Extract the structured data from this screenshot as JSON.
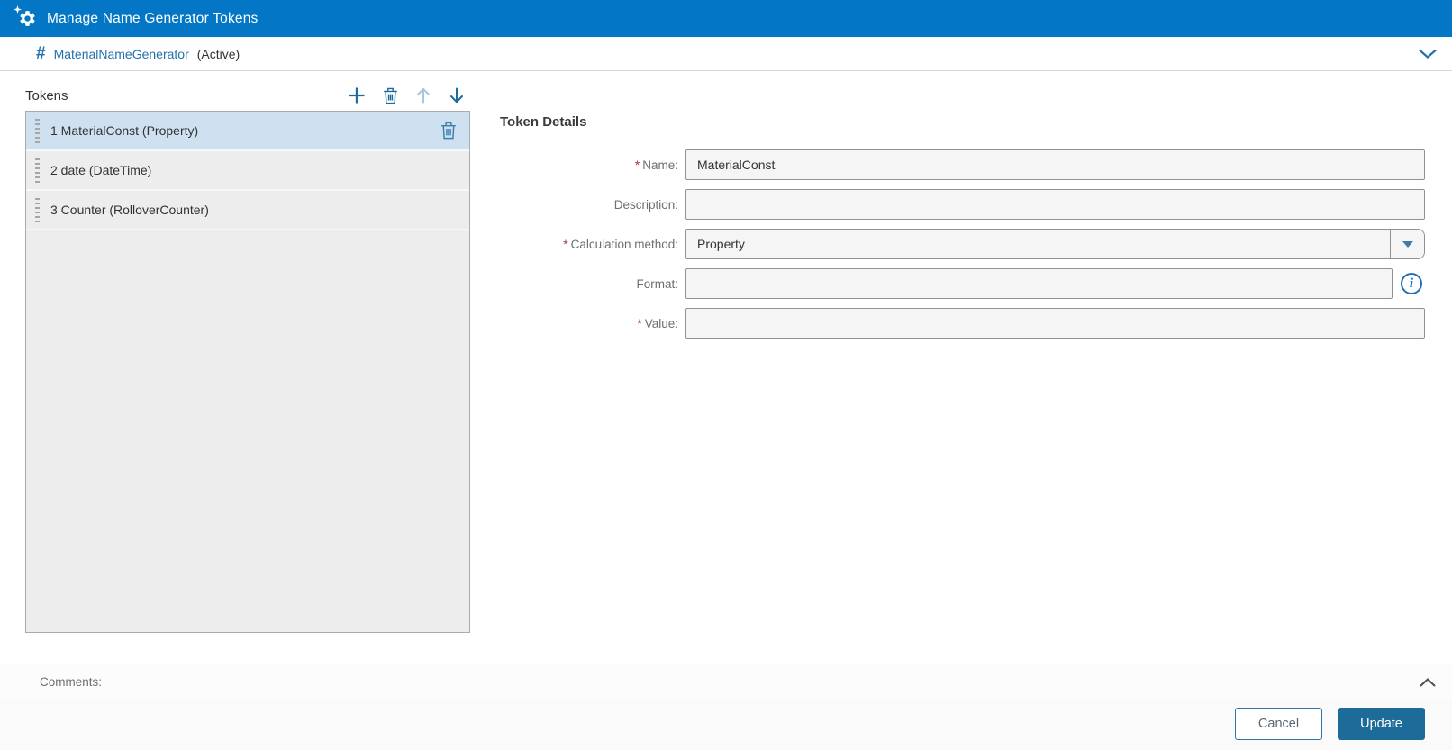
{
  "titlebar": {
    "title": "Manage Name Generator Tokens",
    "icon": "gear-with-spark-icon"
  },
  "subheader": {
    "hash_symbol": "#",
    "generator_name": "MaterialNameGenerator",
    "status": "(Active)",
    "collapse_icon": "chevron-down-icon"
  },
  "tokens_panel": {
    "title": "Tokens",
    "toolbar": {
      "add_icon": "plus-icon",
      "delete_icon": "trash-icon",
      "move_up_icon": "arrow-up-icon",
      "move_up_disabled": true,
      "move_down_icon": "arrow-down-icon"
    },
    "items": [
      {
        "label": "1 MaterialConst (Property)",
        "selected": true,
        "row_delete_icon": "trash-icon"
      },
      {
        "label": "2 date (DateTime)",
        "selected": false
      },
      {
        "label": "3 Counter (RolloverCounter)",
        "selected": false
      }
    ]
  },
  "details_panel": {
    "title": "Token Details",
    "required_marker": "*",
    "fields": {
      "name": {
        "label": "Name:",
        "required": true,
        "value": "MaterialConst",
        "type": "text"
      },
      "description": {
        "label": "Description:",
        "required": false,
        "value": "",
        "type": "text"
      },
      "calculation_method": {
        "label": "Calculation method:",
        "required": true,
        "value": "Property",
        "type": "select"
      },
      "format": {
        "label": "Format:",
        "required": false,
        "value": "",
        "type": "text",
        "info_icon": "info-icon"
      },
      "value": {
        "label": "Value:",
        "required": true,
        "value": "",
        "type": "text"
      }
    }
  },
  "comments": {
    "label": "Comments:",
    "collapse_icon": "chevron-up-icon"
  },
  "footer": {
    "cancel_label": "Cancel",
    "update_label": "Update"
  },
  "colors": {
    "header_bg": "#0377c6",
    "accent_blue": "#2271ab",
    "toolbar_icon_blue": "#1d6a9e",
    "disabled_icon_blue": "#a9c6de",
    "selected_row_bg": "#cfe1f1",
    "input_bg": "#f5f5f5",
    "input_border": "#919191",
    "required_red": "#a13b3e",
    "info_blue": "#2070b8",
    "update_button_bg": "#1c6b99"
  }
}
